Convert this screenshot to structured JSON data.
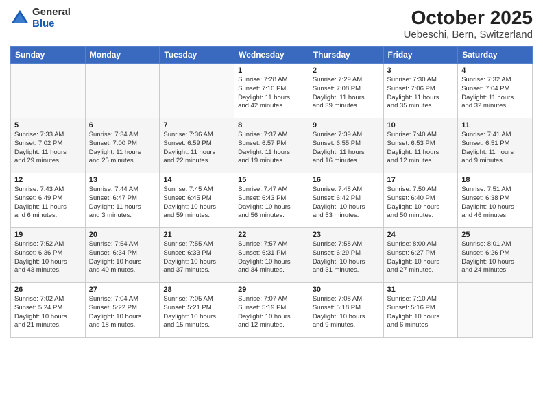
{
  "header": {
    "logo_general": "General",
    "logo_blue": "Blue",
    "title": "October 2025",
    "subtitle": "Uebeschi, Bern, Switzerland"
  },
  "weekdays": [
    "Sunday",
    "Monday",
    "Tuesday",
    "Wednesday",
    "Thursday",
    "Friday",
    "Saturday"
  ],
  "weeks": [
    [
      {
        "day": "",
        "info": ""
      },
      {
        "day": "",
        "info": ""
      },
      {
        "day": "",
        "info": ""
      },
      {
        "day": "1",
        "info": "Sunrise: 7:28 AM\nSunset: 7:10 PM\nDaylight: 11 hours\nand 42 minutes."
      },
      {
        "day": "2",
        "info": "Sunrise: 7:29 AM\nSunset: 7:08 PM\nDaylight: 11 hours\nand 39 minutes."
      },
      {
        "day": "3",
        "info": "Sunrise: 7:30 AM\nSunset: 7:06 PM\nDaylight: 11 hours\nand 35 minutes."
      },
      {
        "day": "4",
        "info": "Sunrise: 7:32 AM\nSunset: 7:04 PM\nDaylight: 11 hours\nand 32 minutes."
      }
    ],
    [
      {
        "day": "5",
        "info": "Sunrise: 7:33 AM\nSunset: 7:02 PM\nDaylight: 11 hours\nand 29 minutes."
      },
      {
        "day": "6",
        "info": "Sunrise: 7:34 AM\nSunset: 7:00 PM\nDaylight: 11 hours\nand 25 minutes."
      },
      {
        "day": "7",
        "info": "Sunrise: 7:36 AM\nSunset: 6:59 PM\nDaylight: 11 hours\nand 22 minutes."
      },
      {
        "day": "8",
        "info": "Sunrise: 7:37 AM\nSunset: 6:57 PM\nDaylight: 11 hours\nand 19 minutes."
      },
      {
        "day": "9",
        "info": "Sunrise: 7:39 AM\nSunset: 6:55 PM\nDaylight: 11 hours\nand 16 minutes."
      },
      {
        "day": "10",
        "info": "Sunrise: 7:40 AM\nSunset: 6:53 PM\nDaylight: 11 hours\nand 12 minutes."
      },
      {
        "day": "11",
        "info": "Sunrise: 7:41 AM\nSunset: 6:51 PM\nDaylight: 11 hours\nand 9 minutes."
      }
    ],
    [
      {
        "day": "12",
        "info": "Sunrise: 7:43 AM\nSunset: 6:49 PM\nDaylight: 11 hours\nand 6 minutes."
      },
      {
        "day": "13",
        "info": "Sunrise: 7:44 AM\nSunset: 6:47 PM\nDaylight: 11 hours\nand 3 minutes."
      },
      {
        "day": "14",
        "info": "Sunrise: 7:45 AM\nSunset: 6:45 PM\nDaylight: 10 hours\nand 59 minutes."
      },
      {
        "day": "15",
        "info": "Sunrise: 7:47 AM\nSunset: 6:43 PM\nDaylight: 10 hours\nand 56 minutes."
      },
      {
        "day": "16",
        "info": "Sunrise: 7:48 AM\nSunset: 6:42 PM\nDaylight: 10 hours\nand 53 minutes."
      },
      {
        "day": "17",
        "info": "Sunrise: 7:50 AM\nSunset: 6:40 PM\nDaylight: 10 hours\nand 50 minutes."
      },
      {
        "day": "18",
        "info": "Sunrise: 7:51 AM\nSunset: 6:38 PM\nDaylight: 10 hours\nand 46 minutes."
      }
    ],
    [
      {
        "day": "19",
        "info": "Sunrise: 7:52 AM\nSunset: 6:36 PM\nDaylight: 10 hours\nand 43 minutes."
      },
      {
        "day": "20",
        "info": "Sunrise: 7:54 AM\nSunset: 6:34 PM\nDaylight: 10 hours\nand 40 minutes."
      },
      {
        "day": "21",
        "info": "Sunrise: 7:55 AM\nSunset: 6:33 PM\nDaylight: 10 hours\nand 37 minutes."
      },
      {
        "day": "22",
        "info": "Sunrise: 7:57 AM\nSunset: 6:31 PM\nDaylight: 10 hours\nand 34 minutes."
      },
      {
        "day": "23",
        "info": "Sunrise: 7:58 AM\nSunset: 6:29 PM\nDaylight: 10 hours\nand 31 minutes."
      },
      {
        "day": "24",
        "info": "Sunrise: 8:00 AM\nSunset: 6:27 PM\nDaylight: 10 hours\nand 27 minutes."
      },
      {
        "day": "25",
        "info": "Sunrise: 8:01 AM\nSunset: 6:26 PM\nDaylight: 10 hours\nand 24 minutes."
      }
    ],
    [
      {
        "day": "26",
        "info": "Sunrise: 7:02 AM\nSunset: 5:24 PM\nDaylight: 10 hours\nand 21 minutes."
      },
      {
        "day": "27",
        "info": "Sunrise: 7:04 AM\nSunset: 5:22 PM\nDaylight: 10 hours\nand 18 minutes."
      },
      {
        "day": "28",
        "info": "Sunrise: 7:05 AM\nSunset: 5:21 PM\nDaylight: 10 hours\nand 15 minutes."
      },
      {
        "day": "29",
        "info": "Sunrise: 7:07 AM\nSunset: 5:19 PM\nDaylight: 10 hours\nand 12 minutes."
      },
      {
        "day": "30",
        "info": "Sunrise: 7:08 AM\nSunset: 5:18 PM\nDaylight: 10 hours\nand 9 minutes."
      },
      {
        "day": "31",
        "info": "Sunrise: 7:10 AM\nSunset: 5:16 PM\nDaylight: 10 hours\nand 6 minutes."
      },
      {
        "day": "",
        "info": ""
      }
    ]
  ]
}
